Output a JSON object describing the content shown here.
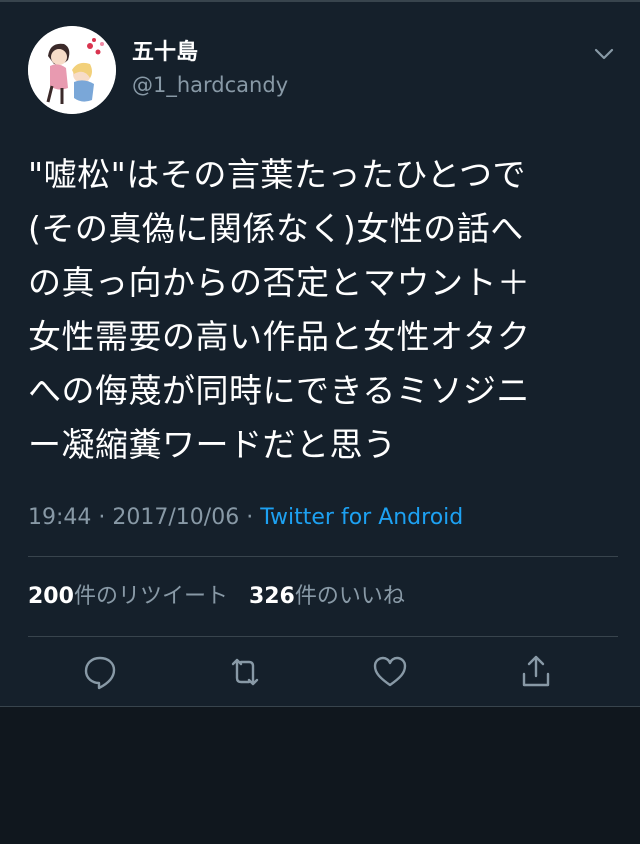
{
  "tweet": {
    "author": {
      "name": "五十島",
      "handle": "@1_hardcandy"
    },
    "lines": [
      "\"嘘松\"はその言葉たったひとつで",
      "(その真偽に関係なく)女性の話へ",
      "の真っ向からの否定とマウント＋",
      "女性需要の高い作品と女性オタク",
      "への侮蔑が同時にできるミソジニ",
      "ー凝縮糞ワードだと思う"
    ],
    "time": "19:44",
    "separator": "·",
    "date": "2017/10/06",
    "source": "Twitter for Android",
    "stats": {
      "retweet_count": "200",
      "retweet_label": "件のリツイート",
      "like_count": "326",
      "like_label": "件のいいね"
    }
  },
  "icons": [
    "chevron-down-icon",
    "reply-icon",
    "retweet-icon",
    "like-icon",
    "share-icon"
  ],
  "colors": {
    "background": "#15202b",
    "text": "#ffffff",
    "secondary": "#8899a6",
    "link": "#1da1f2",
    "divider": "#38444d"
  }
}
